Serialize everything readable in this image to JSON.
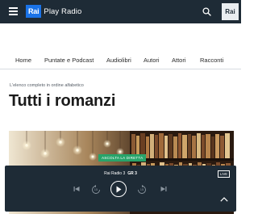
{
  "header": {
    "logo_brand": "Rai",
    "logo_text": "Play Radio",
    "avatar_text": "Rai"
  },
  "nav": {
    "items": [
      {
        "label": "Home"
      },
      {
        "label": "Puntate e Podcast"
      },
      {
        "label": "Audiolibri"
      },
      {
        "label": "Autori"
      },
      {
        "label": "Attori"
      },
      {
        "label": "Racconti"
      }
    ]
  },
  "main": {
    "eyebrow": "L'elenco completo in ordine alfabetico",
    "title": "Tutti i romanzi",
    "hero_badge": "ASCOLTA LA DIRETTA"
  },
  "player": {
    "station": "Rai Radio 3",
    "program": "GR 3",
    "live_label": "LIVE",
    "skip_back_label": "15",
    "skip_forward_label": "15"
  },
  "colors": {
    "topbar": "#1e2b36",
    "logo_blue": "#1a73e8",
    "badge_green": "#28a46a",
    "player_bg": "#1e2b36"
  },
  "icons": [
    "menu-icon",
    "search-icon",
    "previous-icon",
    "rewind-15-icon",
    "play-icon",
    "forward-15-icon",
    "next-icon",
    "chevron-up-icon"
  ]
}
